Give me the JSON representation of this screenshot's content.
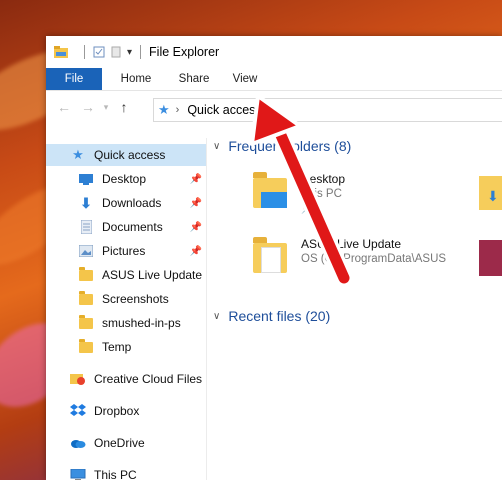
{
  "window": {
    "title": "File Explorer"
  },
  "ribbon": {
    "tabs": [
      {
        "label": "File",
        "active": true
      },
      {
        "label": "Home"
      },
      {
        "label": "Share"
      },
      {
        "label": "View"
      }
    ]
  },
  "address": {
    "path": "Quick access"
  },
  "sidebar": {
    "items": [
      {
        "label": "Quick access",
        "icon": "star-icon",
        "selected": true
      },
      {
        "label": "Desktop",
        "icon": "desktop-icon",
        "pinned": true
      },
      {
        "label": "Downloads",
        "icon": "download-arrow-icon",
        "pinned": true
      },
      {
        "label": "Documents",
        "icon": "documents-icon",
        "pinned": true
      },
      {
        "label": "Pictures",
        "icon": "pictures-icon",
        "pinned": true
      },
      {
        "label": "ASUS Live Update",
        "icon": "folder-icon"
      },
      {
        "label": "Screenshots",
        "icon": "folder-icon"
      },
      {
        "label": "smushed-in-ps",
        "icon": "folder-icon"
      },
      {
        "label": "Temp",
        "icon": "folder-icon"
      },
      {
        "label": "Creative Cloud Files",
        "icon": "creative-cloud-icon"
      },
      {
        "label": "Dropbox",
        "icon": "dropbox-icon"
      },
      {
        "label": "OneDrive",
        "icon": "onedrive-icon"
      },
      {
        "label": "This PC",
        "icon": "computer-icon"
      }
    ]
  },
  "main": {
    "frequent_header": "Frequent folders (8)",
    "frequent": [
      {
        "title": "Desktop",
        "subtitle": "This PC"
      },
      {
        "title": "ASUS Live Update",
        "subtitle": "OS (C:) ProgramData\\ASUS"
      }
    ],
    "recent_header": "Recent files (20)"
  },
  "colors": {
    "accent": "#1a63b8",
    "annotation_arrow": "#e01818"
  }
}
